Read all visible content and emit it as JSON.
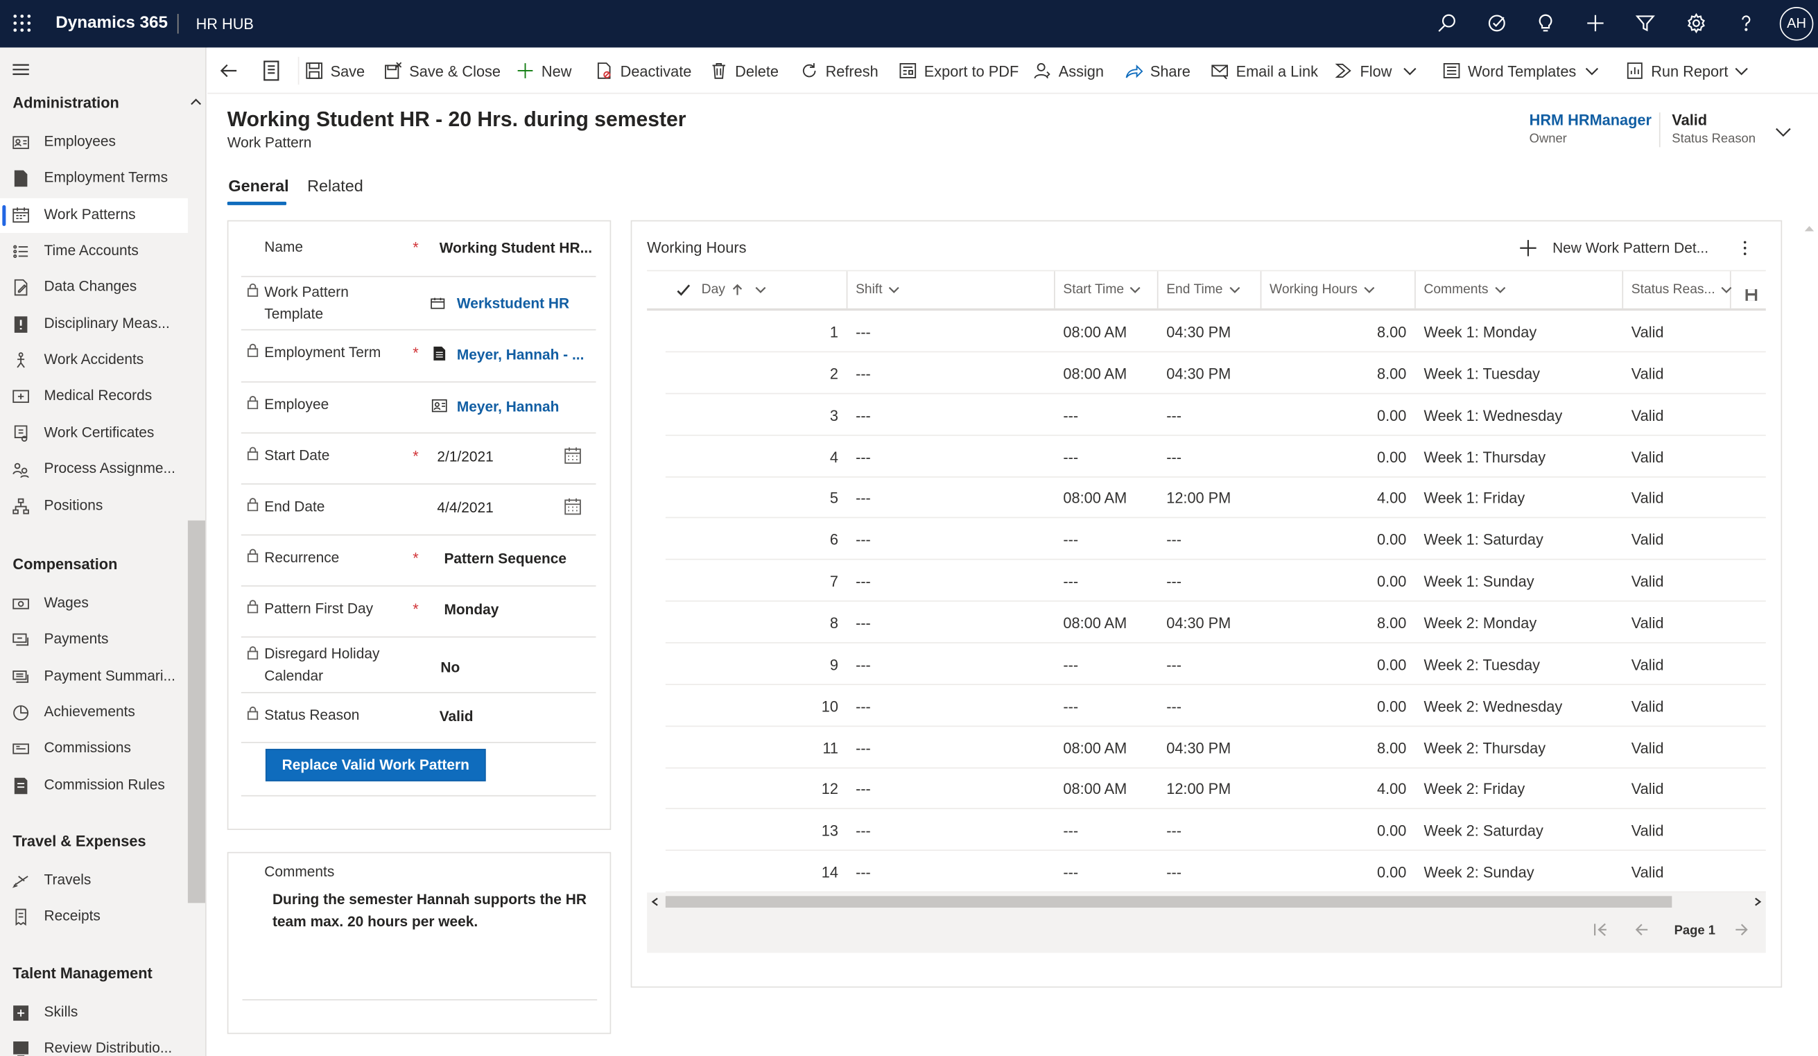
{
  "topbar": {
    "app": "Dynamics 365",
    "area": "HR HUB",
    "avatar": "AH",
    "icons": [
      "search-icon",
      "task-icon",
      "lightbulb-icon",
      "add-icon",
      "filter-icon",
      "settings-icon",
      "help-icon"
    ]
  },
  "sidebar": {
    "groups": [
      {
        "title": "Administration",
        "items": [
          {
            "label": "Employees",
            "icon": "employee-card-icon"
          },
          {
            "label": "Employment Terms",
            "icon": "document-icon"
          },
          {
            "label": "Work Patterns",
            "icon": "calendar-pattern-icon",
            "selected": true
          },
          {
            "label": "Time Accounts",
            "icon": "list-icon"
          },
          {
            "label": "Data Changes",
            "icon": "edit-document-icon"
          },
          {
            "label": "Disciplinary Meas...",
            "icon": "alert-icon"
          },
          {
            "label": "Work Accidents",
            "icon": "accident-icon"
          },
          {
            "label": "Medical Records",
            "icon": "medical-icon"
          },
          {
            "label": "Work Certificates",
            "icon": "certificate-icon"
          },
          {
            "label": "Process Assignme...",
            "icon": "people-process-icon"
          },
          {
            "label": "Positions",
            "icon": "org-chart-icon"
          }
        ]
      },
      {
        "title": "Compensation",
        "items": [
          {
            "label": "Wages",
            "icon": "money-icon"
          },
          {
            "label": "Payments",
            "icon": "payment-icon"
          },
          {
            "label": "Payment Summari...",
            "icon": "payment-summary-icon"
          },
          {
            "label": "Achievements",
            "icon": "achievement-icon"
          },
          {
            "label": "Commissions",
            "icon": "commission-icon"
          },
          {
            "label": "Commission Rules",
            "icon": "rules-icon"
          }
        ]
      },
      {
        "title": "Travel & Expenses",
        "items": [
          {
            "label": "Travels",
            "icon": "travel-icon"
          },
          {
            "label": "Receipts",
            "icon": "receipt-icon"
          }
        ]
      },
      {
        "title": "Talent Management",
        "items": [
          {
            "label": "Skills",
            "icon": "skills-icon"
          },
          {
            "label": "Review Distributio...",
            "icon": "review-icon"
          }
        ]
      }
    ]
  },
  "commands": [
    {
      "label": "Save",
      "icon": "save-icon"
    },
    {
      "label": "Save & Close",
      "icon": "save-close-icon"
    },
    {
      "label": "New",
      "icon": "add-icon"
    },
    {
      "label": "Deactivate",
      "icon": "deactivate-icon"
    },
    {
      "label": "Delete",
      "icon": "delete-icon"
    },
    {
      "label": "Refresh",
      "icon": "refresh-icon"
    },
    {
      "label": "Export to PDF",
      "icon": "pdf-icon"
    },
    {
      "label": "Assign",
      "icon": "assign-icon"
    },
    {
      "label": "Share",
      "icon": "share-icon"
    },
    {
      "label": "Email a Link",
      "icon": "email-icon"
    },
    {
      "label": "Flow",
      "icon": "flow-icon"
    },
    {
      "label": "Word Templates",
      "icon": "word-icon"
    },
    {
      "label": "Run Report",
      "icon": "report-icon"
    }
  ],
  "header": {
    "title": "Working Student HR - 20 Hrs. during semester",
    "entity": "Work Pattern",
    "owner": {
      "value": "HRM HRManager",
      "label": "Owner"
    },
    "status": {
      "value": "Valid",
      "label": "Status Reason"
    }
  },
  "tabs": [
    "General",
    "Related"
  ],
  "form": {
    "name": {
      "label": "Name",
      "value": "Working Student HR..."
    },
    "template": {
      "label": "Work Pattern Template",
      "value": "Werkstudent HR"
    },
    "employment_term": {
      "label": "Employment Term",
      "value": "Meyer, Hannah  - ..."
    },
    "employee": {
      "label": "Employee",
      "value": "Meyer, Hannah"
    },
    "start_date": {
      "label": "Start Date",
      "value": "2/1/2021"
    },
    "end_date": {
      "label": "End Date",
      "value": "4/4/2021"
    },
    "recurrence": {
      "label": "Recurrence",
      "value": "Pattern Sequence"
    },
    "pattern_first_day": {
      "label": "Pattern First Day",
      "value": "Monday"
    },
    "disregard_holiday": {
      "label": "Disregard Holiday Calendar",
      "value": "No"
    },
    "status_reason": {
      "label": "Status Reason",
      "value": "Valid"
    },
    "replace_button": "Replace Valid Work Pattern"
  },
  "comments": {
    "label": "Comments",
    "value": "During the semester Hannah supports the HR team max. 20 hours per week."
  },
  "grid": {
    "title": "Working Hours",
    "new_button": "New Work Pattern Det...",
    "columns": [
      "Day",
      "Shift",
      "Start Time",
      "End Time",
      "Working Hours",
      "Comments",
      "Status Reas..."
    ],
    "rows": [
      {
        "day": "1",
        "shift": "---",
        "start": "08:00 AM",
        "end": "04:30 PM",
        "hours": "8.00",
        "comment": "Week 1: Monday",
        "status": "Valid"
      },
      {
        "day": "2",
        "shift": "---",
        "start": "08:00 AM",
        "end": "04:30 PM",
        "hours": "8.00",
        "comment": "Week 1: Tuesday",
        "status": "Valid"
      },
      {
        "day": "3",
        "shift": "---",
        "start": "---",
        "end": "---",
        "hours": "0.00",
        "comment": "Week 1: Wednesday",
        "status": "Valid"
      },
      {
        "day": "4",
        "shift": "---",
        "start": "---",
        "end": "---",
        "hours": "0.00",
        "comment": "Week 1: Thursday",
        "status": "Valid"
      },
      {
        "day": "5",
        "shift": "---",
        "start": "08:00 AM",
        "end": "12:00 PM",
        "hours": "4.00",
        "comment": "Week 1: Friday",
        "status": "Valid"
      },
      {
        "day": "6",
        "shift": "---",
        "start": "---",
        "end": "---",
        "hours": "0.00",
        "comment": "Week 1: Saturday",
        "status": "Valid"
      },
      {
        "day": "7",
        "shift": "---",
        "start": "---",
        "end": "---",
        "hours": "0.00",
        "comment": "Week 1: Sunday",
        "status": "Valid"
      },
      {
        "day": "8",
        "shift": "---",
        "start": "08:00 AM",
        "end": "04:30 PM",
        "hours": "8.00",
        "comment": "Week 2: Monday",
        "status": "Valid"
      },
      {
        "day": "9",
        "shift": "---",
        "start": "---",
        "end": "---",
        "hours": "0.00",
        "comment": "Week 2: Tuesday",
        "status": "Valid"
      },
      {
        "day": "10",
        "shift": "---",
        "start": "---",
        "end": "---",
        "hours": "0.00",
        "comment": "Week 2: Wednesday",
        "status": "Valid"
      },
      {
        "day": "11",
        "shift": "---",
        "start": "08:00 AM",
        "end": "04:30 PM",
        "hours": "8.00",
        "comment": "Week 2: Thursday",
        "status": "Valid"
      },
      {
        "day": "12",
        "shift": "---",
        "start": "08:00 AM",
        "end": "12:00 PM",
        "hours": "4.00",
        "comment": "Week 2: Friday",
        "status": "Valid"
      },
      {
        "day": "13",
        "shift": "---",
        "start": "---",
        "end": "---",
        "hours": "0.00",
        "comment": "Week 2: Saturday",
        "status": "Valid"
      },
      {
        "day": "14",
        "shift": "---",
        "start": "---",
        "end": "---",
        "hours": "0.00",
        "comment": "Week 2: Sunday",
        "status": "Valid"
      }
    ],
    "page": "Page 1"
  }
}
